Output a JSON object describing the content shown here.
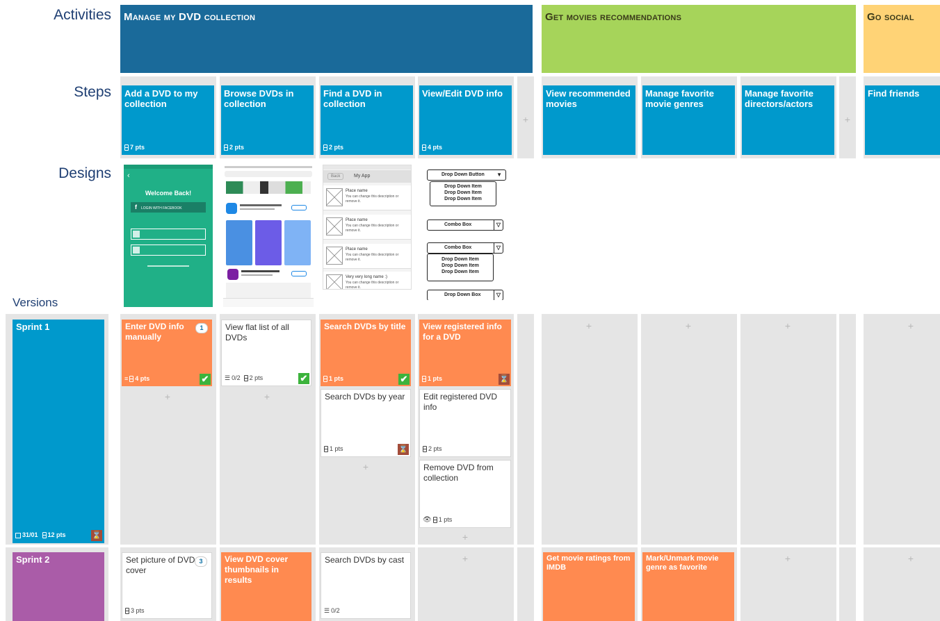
{
  "labels": {
    "activities": "Activities",
    "steps": "Steps",
    "designs": "Designs",
    "versions": "Versions"
  },
  "activities": [
    {
      "title": "Manage my DVD collection",
      "color": "#1a6a9a"
    },
    {
      "title": "Get movies recommendations",
      "color": "#a6d45a"
    },
    {
      "title": "Go social",
      "color": "#ffd376"
    }
  ],
  "steps": [
    {
      "title": "Add a DVD to my collection",
      "pts": "7 pts"
    },
    {
      "title": "Browse DVDs in collection",
      "pts": "2 pts"
    },
    {
      "title": "Find a DVD in collection",
      "pts": "2 pts"
    },
    {
      "title": "View/Edit DVD info",
      "pts": "4 pts"
    },
    {
      "title": "View recommended movies"
    },
    {
      "title": "Manage favorite movie genres"
    },
    {
      "title": "Manage favorite directors/actors"
    },
    {
      "title": "Find friends"
    }
  ],
  "plus": "+",
  "designs": {
    "mock1": {
      "welcome": "Welcome Back!",
      "facebook": "LOGIN WITH FACEBOOK"
    },
    "mock3": {
      "back": "Back",
      "title": "My App",
      "items": [
        {
          "name": "Place name",
          "desc": "You can change this description or remove it."
        },
        {
          "name": "Place name",
          "desc": "You can change this description or remove it."
        },
        {
          "name": "Place name",
          "desc": "You can change this description or remove it."
        },
        {
          "name": "Very very long name :)",
          "desc": "You can change this description or remove it."
        }
      ]
    },
    "mock4": {
      "dropdown_button": "Drop Down Button",
      "item": "Drop Down Item",
      "combo": "Combo Box",
      "dropbox": "Drop Down Box"
    }
  },
  "sprints": [
    {
      "name": "Sprint 1",
      "date": "31/01",
      "pts": "12 pts",
      "color": "#0099cc"
    },
    {
      "name": "Sprint 2",
      "color": "#aa5ca8"
    }
  ],
  "stories": {
    "s1_enter": {
      "title": "Enter DVD info manually",
      "pts": "4 pts",
      "comments": "1"
    },
    "s1_flat": {
      "title": "View flat list of all DVDs",
      "tasks": "0/2",
      "pts": "2 pts"
    },
    "s1_title": {
      "title": "Search DVDs by title",
      "pts": "1 pts"
    },
    "s1_year": {
      "title": "Search DVDs by year",
      "pts": "1 pts"
    },
    "s1_viewreg": {
      "title": "View registered info for a DVD",
      "pts": "1 pts"
    },
    "s1_editreg": {
      "title": "Edit registered DVD info",
      "pts": "2 pts"
    },
    "s1_remove": {
      "title": "Remove DVD from collection",
      "pts": "1 pts"
    },
    "s2_picture": {
      "title": "Set picture of DVD cover",
      "pts": "3 pts",
      "comments": "3"
    },
    "s2_thumbs": {
      "title": "View DVD cover thumbnails in results"
    },
    "s2_cast": {
      "title": "Search DVDs by cast",
      "tasks": "0/2"
    },
    "s2_ratings": {
      "title": "Get movie ratings from IMDB"
    },
    "s2_genre": {
      "title": "Mark/Unmark movie genre as favorite"
    }
  }
}
